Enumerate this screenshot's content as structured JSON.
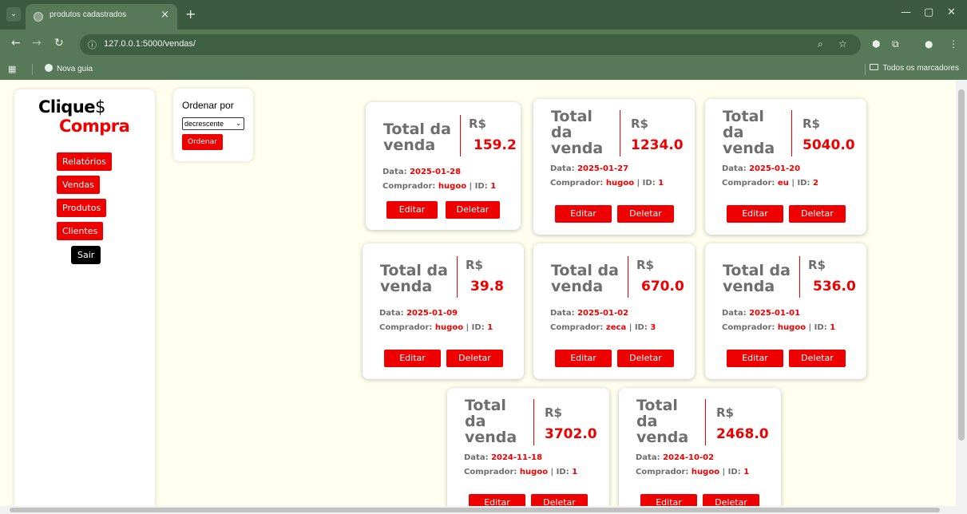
{
  "browser": {
    "tab_title": "produtos cadastrados",
    "url": "127.0.0.1:5000/vendas/",
    "bookmark_item": "Nova guia",
    "bookmarks_all": "Todos os marcadores"
  },
  "sidebar": {
    "logo_line1": "Clique",
    "logo_dollar": "$",
    "logo_line2": "Compra",
    "items": [
      {
        "label": "Relatórios"
      },
      {
        "label": "Vendas"
      },
      {
        "label": "Produtos"
      },
      {
        "label": "Clientes"
      }
    ],
    "exit_label": "Sair"
  },
  "sort": {
    "label": "Ordenar por",
    "selected": "decrescente",
    "button": "Ordenar"
  },
  "labels": {
    "total_title": "Total da venda",
    "currency": "R$",
    "date": "Data:",
    "buyer": "Comprador:",
    "id": "| ID:",
    "edit": "Editar",
    "delete": "Deletar"
  },
  "sales": [
    {
      "value": "159.2",
      "date": "2025-01-28",
      "buyer": "hugoo",
      "id": "1"
    },
    {
      "value": "1234.0",
      "date": "2025-01-27",
      "buyer": "hugoo",
      "id": "1"
    },
    {
      "value": "5040.0",
      "date": "2025-01-20",
      "buyer": "eu",
      "id": "2"
    },
    {
      "value": "39.8",
      "date": "2025-01-09",
      "buyer": "hugoo",
      "id": "1"
    },
    {
      "value": "670.0",
      "date": "2025-01-02",
      "buyer": "zeca",
      "id": "3"
    },
    {
      "value": "536.0",
      "date": "2025-01-01",
      "buyer": "hugoo",
      "id": "1"
    },
    {
      "value": "3702.0",
      "date": "2024-11-18",
      "buyer": "hugoo",
      "id": "1"
    },
    {
      "value": "2468.0",
      "date": "2024-10-02",
      "buyer": "hugoo",
      "id": "1"
    }
  ],
  "colors": {
    "accent": "#ee0000",
    "chrome": "#58785a",
    "page_bg": "#fffff0"
  }
}
